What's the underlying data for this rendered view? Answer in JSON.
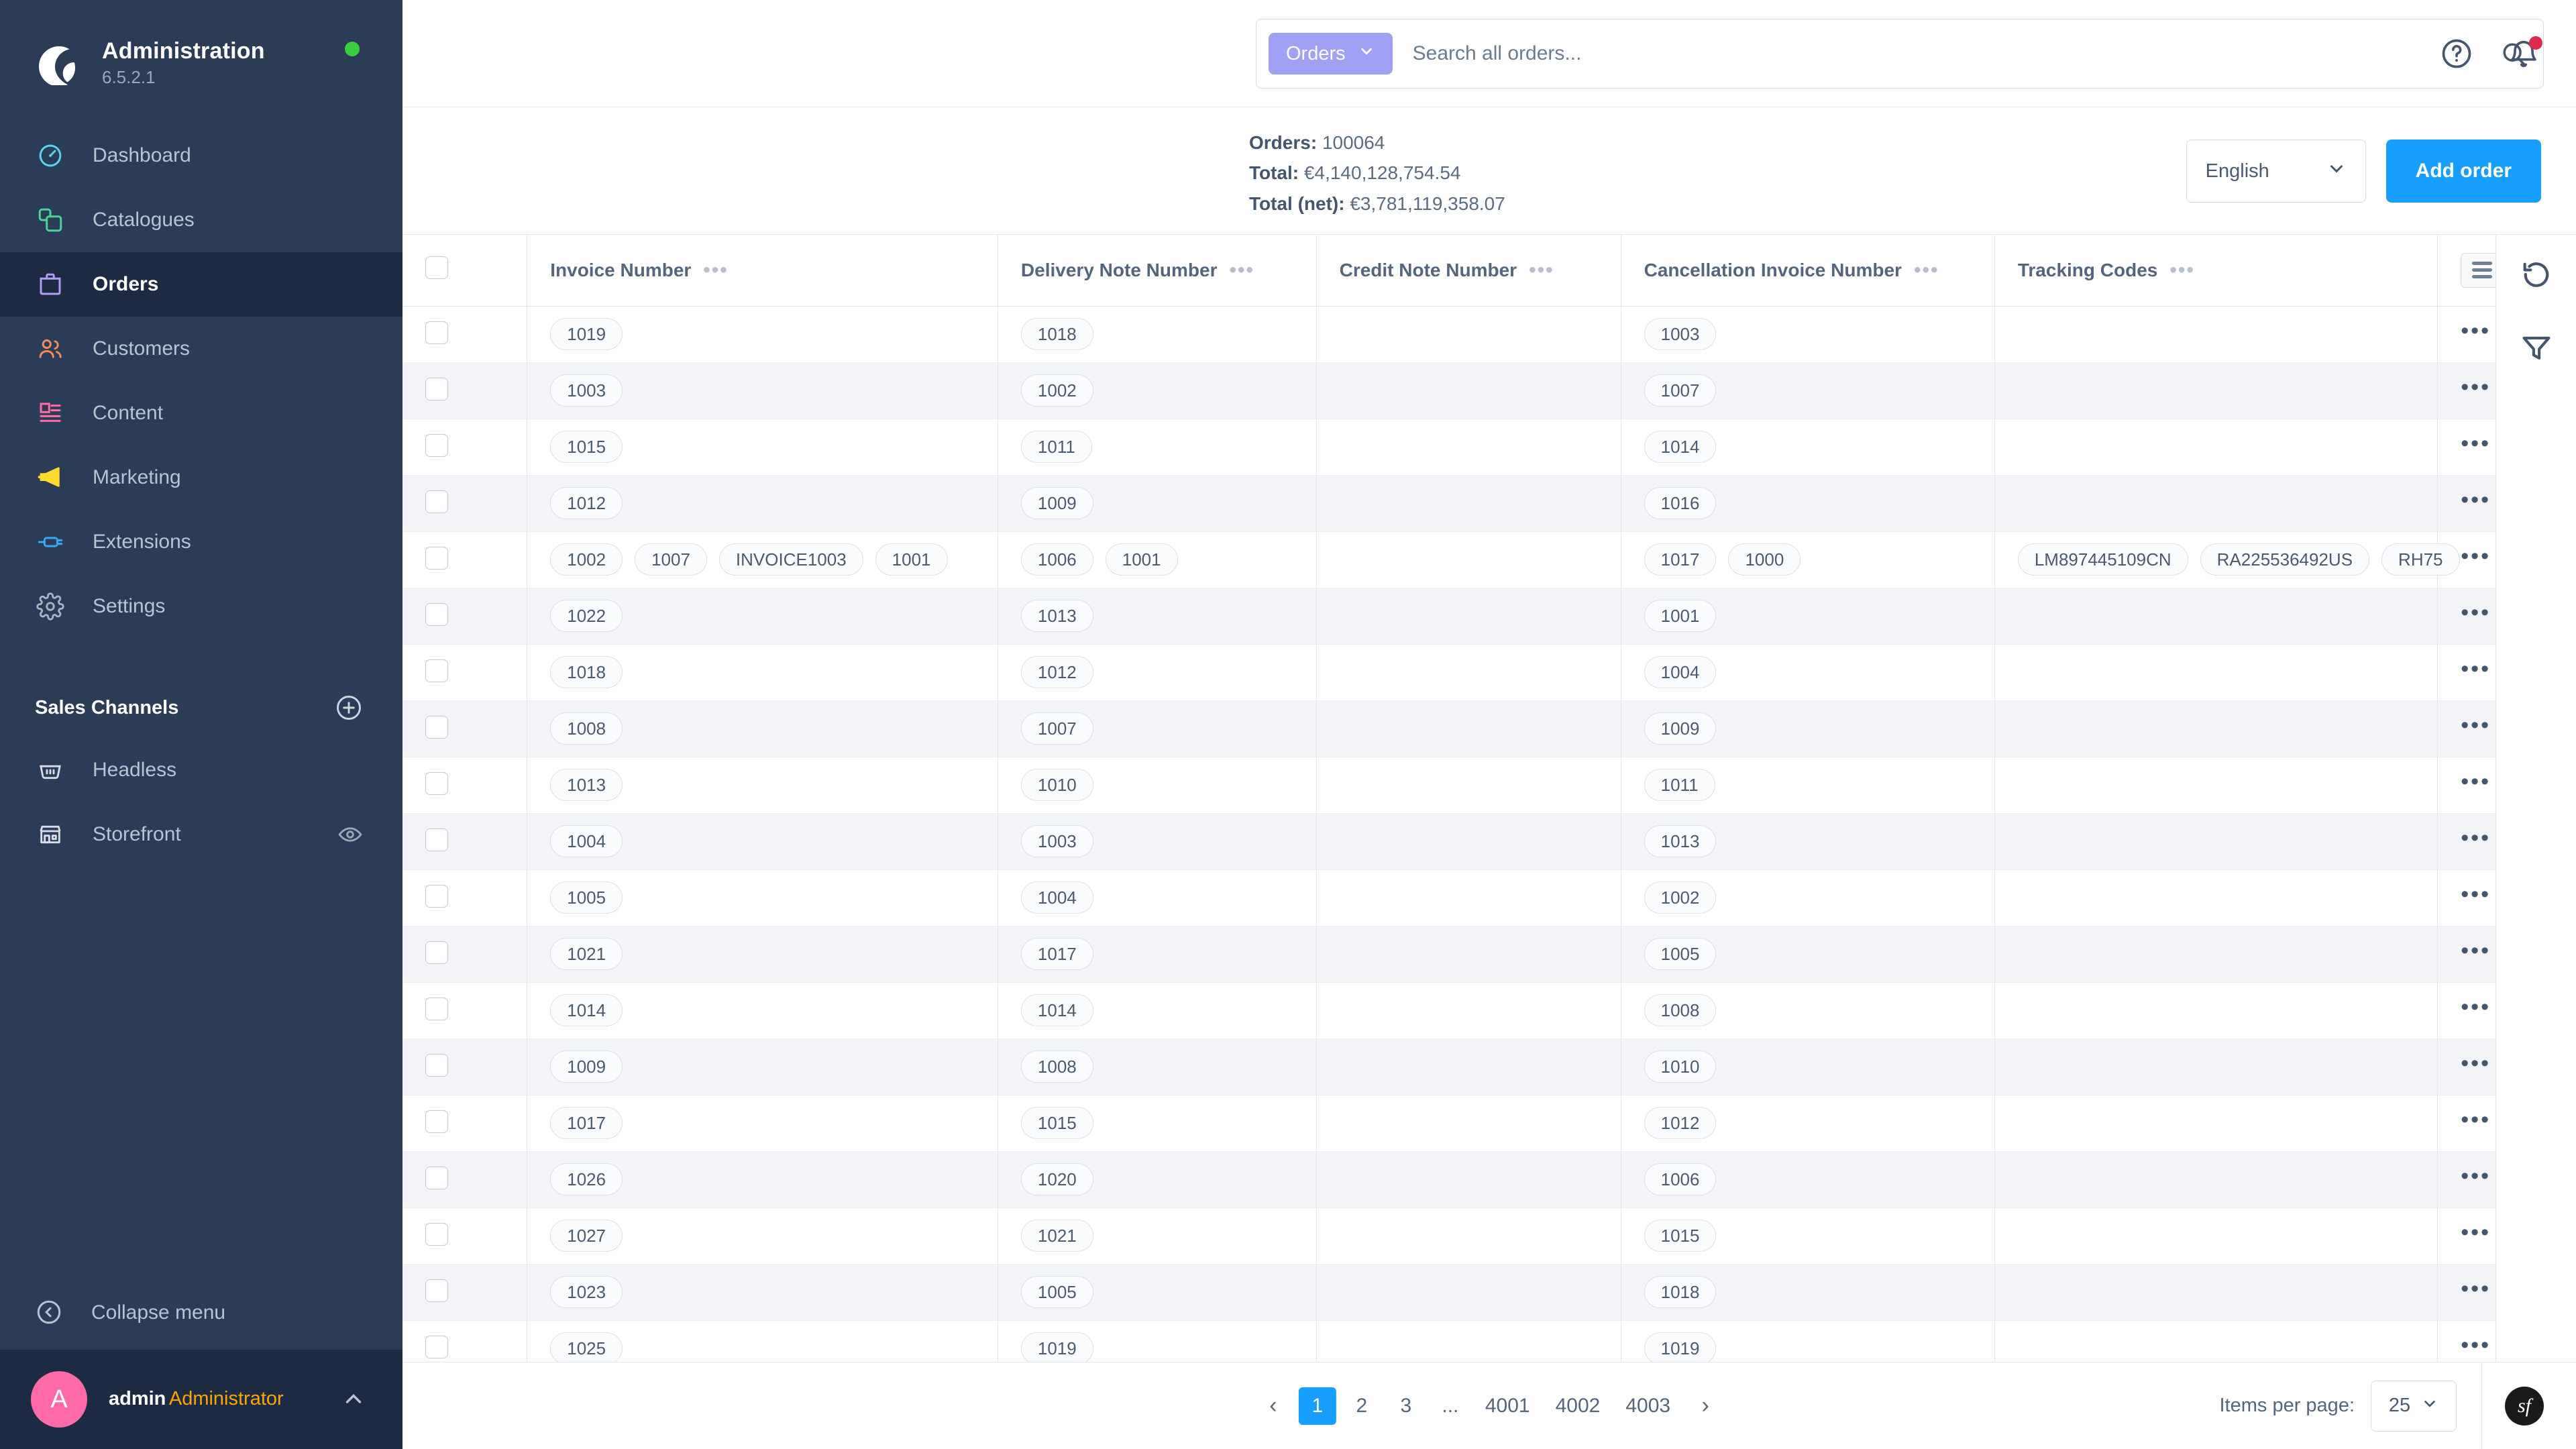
{
  "sidebar": {
    "brand": {
      "title": "Administration",
      "version": "6.5.2.1",
      "status_color": "#37d03b"
    },
    "items": [
      {
        "label": "Dashboard",
        "icon": "gauge-icon",
        "color": "#5ad5f0",
        "active": false
      },
      {
        "label": "Catalogues",
        "icon": "catalogue-icon",
        "color": "#4dd599",
        "active": false
      },
      {
        "label": "Orders",
        "icon": "bag-icon",
        "color": "#b39ef5",
        "active": true
      },
      {
        "label": "Customers",
        "icon": "users-icon",
        "color": "#f58b5c",
        "active": false
      },
      {
        "label": "Content",
        "icon": "content-icon",
        "color": "#ff6fa5",
        "active": false
      },
      {
        "label": "Marketing",
        "icon": "megaphone-icon",
        "color": "#ffd92e",
        "active": false
      },
      {
        "label": "Extensions",
        "icon": "plug-icon",
        "color": "#37a9f7",
        "active": false
      },
      {
        "label": "Settings",
        "icon": "gear-icon",
        "color": "#aab4c2",
        "active": false
      }
    ],
    "sales_channels": {
      "title": "Sales Channels",
      "add_label": "plus-circle-icon",
      "items": [
        {
          "label": "Headless",
          "icon": "basket-icon",
          "has_eye": false
        },
        {
          "label": "Storefront",
          "icon": "storefront-icon",
          "has_eye": true
        }
      ]
    },
    "collapse_label": "Collapse menu",
    "user": {
      "initial": "A",
      "name": "admin",
      "role": "Administrator"
    }
  },
  "topbar": {
    "search": {
      "scope_label": "Orders",
      "placeholder": "Search all orders...",
      "value": ""
    },
    "help_icon": "question-circle-icon",
    "notifications_icon": "bell-icon"
  },
  "summary": {
    "orders_label": "Orders:",
    "orders_value": "100064",
    "total_label": "Total:",
    "total_value": "€4,140,128,754.54",
    "total_net_label": "Total (net):",
    "total_net_value": "€3,781,119,358.07",
    "language": "English",
    "add_order_label": "Add order",
    "accent_color": "#189eff"
  },
  "table": {
    "columns": [
      {
        "key": "invoice",
        "label": "Invoice Number"
      },
      {
        "key": "delivery",
        "label": "Delivery Note Number"
      },
      {
        "key": "credit",
        "label": "Credit Note Number"
      },
      {
        "key": "cancellation",
        "label": "Cancellation Invoice Number"
      },
      {
        "key": "tracking",
        "label": "Tracking Codes"
      }
    ],
    "rows": [
      {
        "invoice": [
          "1019"
        ],
        "delivery": [
          "1018"
        ],
        "credit": [],
        "cancellation": [
          "1003"
        ],
        "tracking": []
      },
      {
        "invoice": [
          "1003"
        ],
        "delivery": [
          "1002"
        ],
        "credit": [],
        "cancellation": [
          "1007"
        ],
        "tracking": []
      },
      {
        "invoice": [
          "1015"
        ],
        "delivery": [
          "1011"
        ],
        "credit": [],
        "cancellation": [
          "1014"
        ],
        "tracking": []
      },
      {
        "invoice": [
          "1012"
        ],
        "delivery": [
          "1009"
        ],
        "credit": [],
        "cancellation": [
          "1016"
        ],
        "tracking": []
      },
      {
        "invoice": [
          "1002",
          "1007",
          "INVOICE1003",
          "1001"
        ],
        "delivery": [
          "1006",
          "1001"
        ],
        "credit": [],
        "cancellation": [
          "1017",
          "1000"
        ],
        "tracking": [
          "LM897445109CN",
          "RA225536492US",
          "RH75"
        ]
      },
      {
        "invoice": [
          "1022"
        ],
        "delivery": [
          "1013"
        ],
        "credit": [],
        "cancellation": [
          "1001"
        ],
        "tracking": []
      },
      {
        "invoice": [
          "1018"
        ],
        "delivery": [
          "1012"
        ],
        "credit": [],
        "cancellation": [
          "1004"
        ],
        "tracking": []
      },
      {
        "invoice": [
          "1008"
        ],
        "delivery": [
          "1007"
        ],
        "credit": [],
        "cancellation": [
          "1009"
        ],
        "tracking": []
      },
      {
        "invoice": [
          "1013"
        ],
        "delivery": [
          "1010"
        ],
        "credit": [],
        "cancellation": [
          "1011"
        ],
        "tracking": []
      },
      {
        "invoice": [
          "1004"
        ],
        "delivery": [
          "1003"
        ],
        "credit": [],
        "cancellation": [
          "1013"
        ],
        "tracking": []
      },
      {
        "invoice": [
          "1005"
        ],
        "delivery": [
          "1004"
        ],
        "credit": [],
        "cancellation": [
          "1002"
        ],
        "tracking": []
      },
      {
        "invoice": [
          "1021"
        ],
        "delivery": [
          "1017"
        ],
        "credit": [],
        "cancellation": [
          "1005"
        ],
        "tracking": []
      },
      {
        "invoice": [
          "1014"
        ],
        "delivery": [
          "1014"
        ],
        "credit": [],
        "cancellation": [
          "1008"
        ],
        "tracking": []
      },
      {
        "invoice": [
          "1009"
        ],
        "delivery": [
          "1008"
        ],
        "credit": [],
        "cancellation": [
          "1010"
        ],
        "tracking": []
      },
      {
        "invoice": [
          "1017"
        ],
        "delivery": [
          "1015"
        ],
        "credit": [],
        "cancellation": [
          "1012"
        ],
        "tracking": []
      },
      {
        "invoice": [
          "1026"
        ],
        "delivery": [
          "1020"
        ],
        "credit": [],
        "cancellation": [
          "1006"
        ],
        "tracking": []
      },
      {
        "invoice": [
          "1027"
        ],
        "delivery": [
          "1021"
        ],
        "credit": [],
        "cancellation": [
          "1015"
        ],
        "tracking": []
      },
      {
        "invoice": [
          "1023"
        ],
        "delivery": [
          "1005"
        ],
        "credit": [],
        "cancellation": [
          "1018"
        ],
        "tracking": []
      },
      {
        "invoice": [
          "1025"
        ],
        "delivery": [
          "1019"
        ],
        "credit": [],
        "cancellation": [
          "1019"
        ],
        "tracking": []
      }
    ],
    "row_action_label": "•••",
    "column_menu_label": "•••",
    "settings_icon": "grid-settings-icon"
  },
  "rail": {
    "refresh_icon": "refresh-icon",
    "filter_icon": "filter-icon"
  },
  "footer": {
    "prev_label": "‹",
    "next_label": "›",
    "pages": [
      "1",
      "2",
      "3",
      "...",
      "4001",
      "4002",
      "4003"
    ],
    "current_page": "1",
    "items_per_page_label": "Items per page:",
    "items_per_page_value": "25",
    "symfony_mark": "sf"
  }
}
